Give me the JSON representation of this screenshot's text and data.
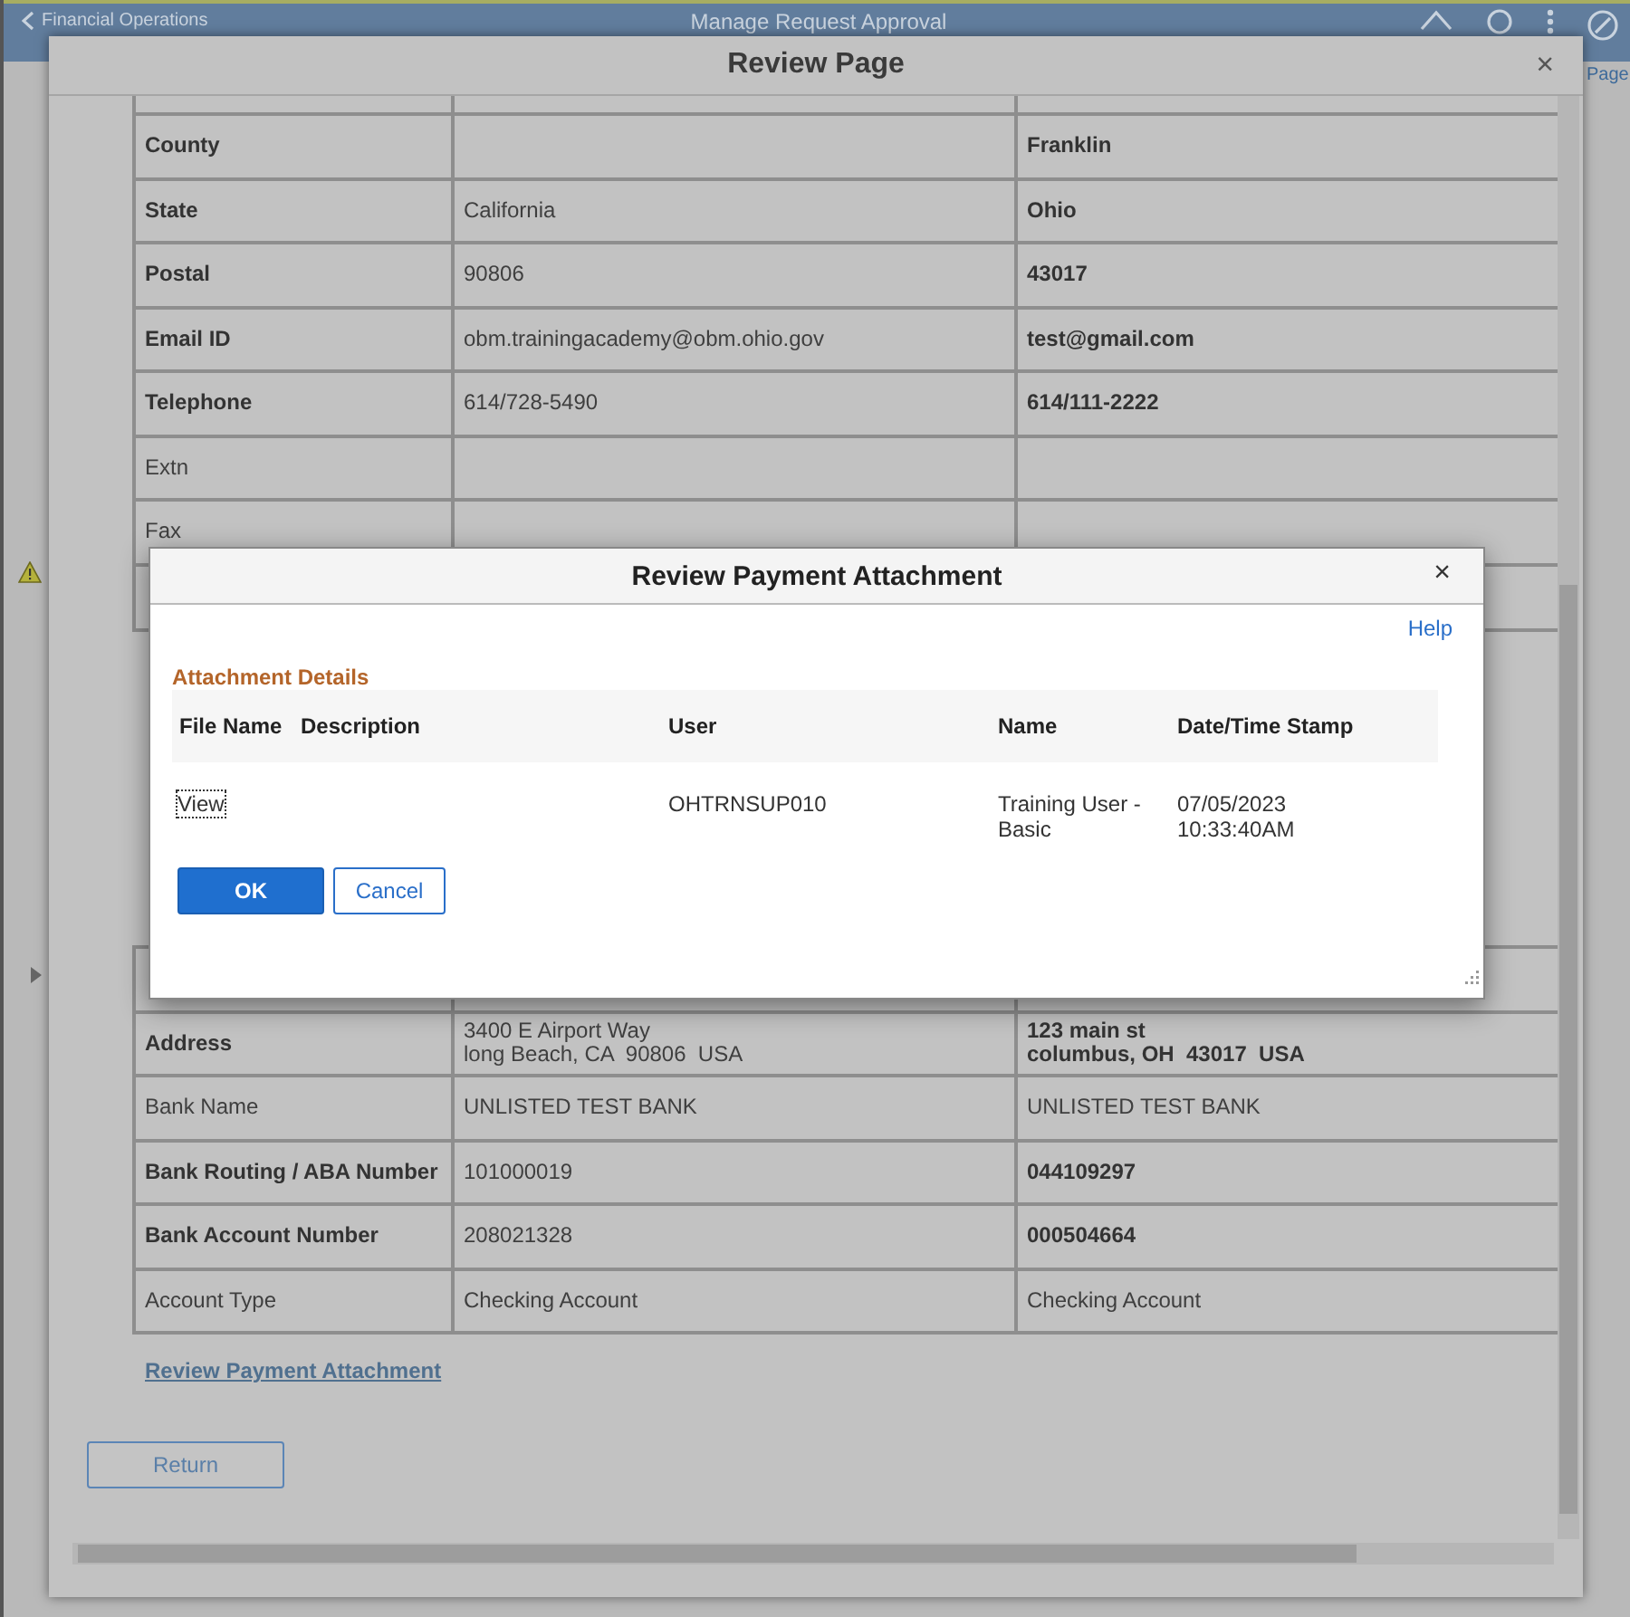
{
  "app_header": {
    "back_label": "Financial Operations",
    "title": "Manage Request Approval",
    "side_link": "Page"
  },
  "review_modal": {
    "title": "Review Page",
    "close": "×",
    "rows_top": [
      {
        "label": "County",
        "proposed": "Franklin",
        "changed": true
      },
      {
        "label": "State",
        "current": "California",
        "proposed": "Ohio",
        "changed": true
      },
      {
        "label": "Postal",
        "current": "90806",
        "proposed": "43017",
        "changed": true
      },
      {
        "label": "Email ID",
        "current": "obm.trainingacademy@obm.ohio.gov",
        "proposed": "test@gmail.com",
        "changed": true
      },
      {
        "label": "Telephone",
        "current": "614/728-5490",
        "proposed": "614/111-2222",
        "changed": true
      },
      {
        "label": "Extn",
        "changed": false
      },
      {
        "label": "Fax",
        "changed": false
      }
    ],
    "rows_bottom": [
      {
        "label": "Address",
        "current": "3400 E Airport Way\nlong Beach, CA  90806  USA",
        "proposed": "123 main st\ncolumbus, OH  43017  USA",
        "changed": true
      },
      {
        "label": "Bank Name",
        "current": "UNLISTED TEST BANK",
        "proposed": "UNLISTED TEST BANK",
        "changed": false
      },
      {
        "label": "Bank Routing / ABA Number",
        "current": "101000019",
        "proposed": "044109297",
        "changed": true
      },
      {
        "label": "Bank Account Number",
        "current": "208021328",
        "proposed": "000504664",
        "changed": true
      },
      {
        "label": "Account Type",
        "current": "Checking Account",
        "proposed": "Checking Account",
        "changed": false
      }
    ],
    "link": "Review Payment Attachment",
    "return_button": "Return"
  },
  "attachment_dialog": {
    "title": "Review Payment Attachment",
    "close": "×",
    "help": "Help",
    "section_title": "Attachment Details",
    "columns": [
      "File Name",
      "Description",
      "User",
      "Name",
      "Date/Time Stamp"
    ],
    "rows": [
      {
        "file_name": "View",
        "focused": true,
        "user": "OHTRNSUP010",
        "name": "Training User - Basic",
        "timestamp": "07/05/2023 10:33:40AM"
      }
    ],
    "buttons": [
      {
        "label": "OK",
        "kind": "primary"
      },
      {
        "label": "Cancel",
        "kind": "secondary"
      }
    ]
  }
}
